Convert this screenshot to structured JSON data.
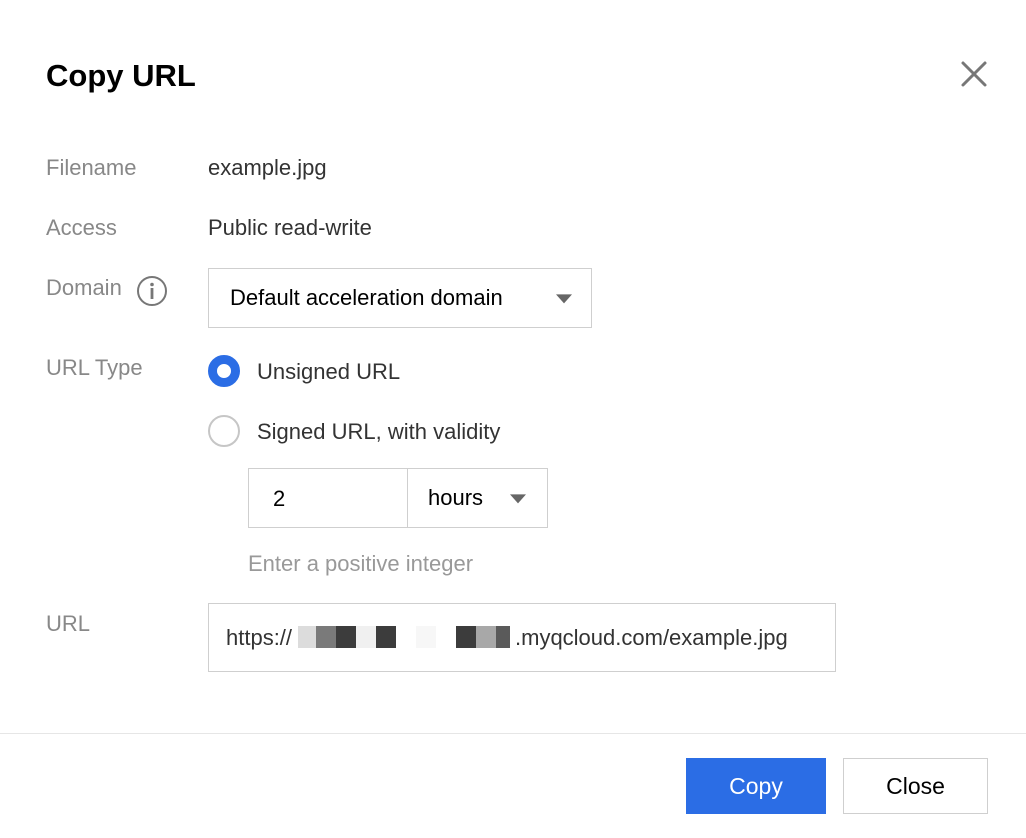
{
  "dialog": {
    "title": "Copy URL",
    "close_icon": "close-icon"
  },
  "fields": {
    "filename_label": "Filename",
    "filename_value": "example.jpg",
    "access_label": "Access",
    "access_value": "Public read-write",
    "domain_label": "Domain",
    "domain_info_icon": "info-icon",
    "domain_selected": "Default acceleration domain",
    "url_type_label": "URL Type",
    "url_type_options": [
      {
        "label": "Unsigned URL",
        "checked": true
      },
      {
        "label": "Signed URL, with validity",
        "checked": false
      }
    ],
    "validity_value": "2",
    "validity_unit": "hours",
    "validity_hint": "Enter a positive integer",
    "url_label": "URL",
    "url_prefix": "https://",
    "url_suffix": ".myqcloud.com/example.jpg"
  },
  "footer": {
    "copy_label": "Copy",
    "close_label": "Close"
  },
  "colors": {
    "primary": "#2b6de5",
    "label_gray": "#888888",
    "hint_gray": "#999999",
    "border": "#cfcfcf"
  }
}
